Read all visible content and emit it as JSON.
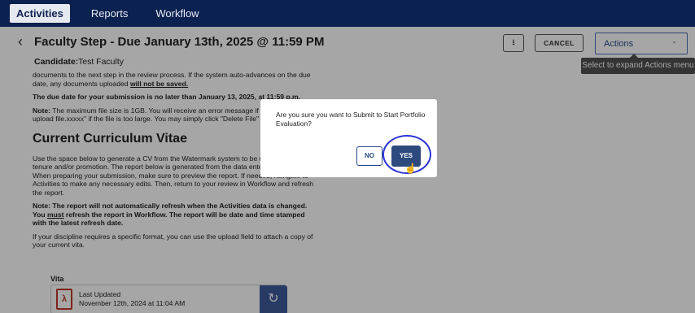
{
  "nav": {
    "tabs": [
      "Activities",
      "Reports",
      "Workflow"
    ]
  },
  "header": {
    "title": "Faculty Step - Due January 13th, 2025 @ 11:59 PM",
    "candidate_label": "Candidate:",
    "candidate_value": "Test Faculty",
    "cancel_label": "CANCEL",
    "actions_label": "Actions",
    "actions_tooltip": "Select to expand Actions menu"
  },
  "content": {
    "para1_a": "documents to the next step in the review process. If the system auto-advances on the due date, any documents uploaded ",
    "para1_u": "will not be saved.",
    "para2": "The due date for your submission is no later than January 13, 2025, at 11:59 p.m.",
    "note1_b": "Note:",
    "note1": " The maximum file size is 1GB. You will receive an error message if you attempt to upload file.xxxxx\" if the file is too large. You may simply click \"Delete File\"",
    "heading": "Current Curriculum Vitae",
    "para3": "Use the space below to generate a CV from the Watermark system to be used in your tenure and/or promotion. The report below is generated from the data entered into Activities. When preparing your submission, make sure to preview the report. If needed, navigate to Activities to make any necessary edits. Then, return to your review in Workflow and refresh the report.",
    "note2_a": "Note: The report will not automatically refresh when the Activities data is changed. You ",
    "note2_u": "must",
    "note2_b": " refresh the report in Workflow. The report will be date and time stamped with the latest refresh date.",
    "para4": "If your discipline requires a specific format, you can use the upload field to attach a copy of your current vita."
  },
  "vita": {
    "label": "Vita",
    "last_updated_label": "Last Updated",
    "last_updated_value": "November 12th, 2024 at 11:04 AM"
  },
  "modal": {
    "message": "Are you sure you want to Submit to Start Portfolio Evaluation?",
    "no_label": "NO",
    "yes_label": "YES"
  },
  "icons": {
    "back": "chevron-left-icon",
    "download": "download-icon",
    "pdf": "pdf-file-icon",
    "refresh": "refresh-icon",
    "cursor": "hand-pointer-icon"
  }
}
